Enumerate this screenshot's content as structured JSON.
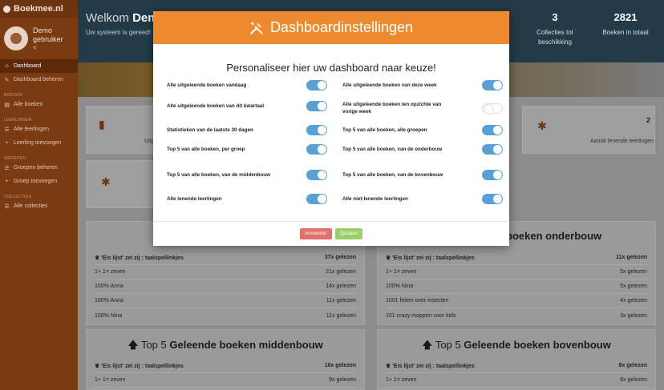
{
  "brand": {
    "name": "Boekmee.nl"
  },
  "user": {
    "name": "Demo gebruiker",
    "arrow": "<"
  },
  "sidebar": {
    "dashboard": "Dashboard",
    "dashboard_manage": "Dashboard beheren",
    "section_books": "BOEKEN",
    "all_books": "Alle boeken",
    "section_students": "LEERLINGEN",
    "all_students": "Alle leerlingen",
    "add_student": "Leerling toevoegen",
    "section_groups": "GROEPEN",
    "manage_groups": "Groepen beheren",
    "add_group": "Groep toevoegen",
    "section_collections": "COLLECTIES",
    "all_collections": "Alle collecties"
  },
  "hero": {
    "welcome_prefix": "Welkom",
    "welcome_name": "Demo",
    "sub": "Uw systeem is gereed!",
    "stat1_value": "3",
    "stat1_label": "Collecties tot beschikking",
    "stat2_value": "2821",
    "stat2_label": "Boeken in totaal"
  },
  "cards": {
    "partial_left": "Uitg",
    "lending_count": "2",
    "lending_label": "Aantal lenende leerlingen"
  },
  "panels": {
    "top_right_title": "boeken onderbouw",
    "bottom_left_title_pre": "Top 5",
    "bottom_left_title_bold": "Geleende boeken middenbouw",
    "bottom_right_title_pre": "Top 5",
    "bottom_right_title_bold": "Geleende boeken bovenbouw",
    "left_rows": [
      {
        "t": "'Eis lijst' zei zij : taalspellinkjes",
        "v": "37x gelezen"
      },
      {
        "t": "1+ 1= zeven",
        "v": "21x gelezen"
      },
      {
        "t": "100% Anna",
        "v": "14x gelezen"
      },
      {
        "t": "100% Anna",
        "v": "11x gelezen"
      },
      {
        "t": "100% Nina",
        "v": "11x gelezen"
      }
    ],
    "right_rows": [
      {
        "t": "'Eis lijst' zei zij : taalspellinkjes",
        "v": "11x gelezen"
      },
      {
        "t": "1+ 1= zeven",
        "v": "5x gelezen"
      },
      {
        "t": "100% Nina",
        "v": "5x gelezen"
      },
      {
        "t": "1001 feiten over insecten",
        "v": "4x gelezen"
      },
      {
        "t": "101 crazy moppen voor kids",
        "v": "3x gelezen"
      }
    ],
    "bl_rows": [
      {
        "t": "'Eis lijst' zei zij : taalspellinkjes",
        "v": "16x gelezen"
      },
      {
        "t": "1+ 1= zeven",
        "v": "9x gelezen"
      }
    ],
    "br_rows": [
      {
        "t": "'Eis lijst' zei zij : taalspellinkjes",
        "v": "8x gelezen"
      },
      {
        "t": "1+ 1= zeven",
        "v": "6x gelezen"
      }
    ]
  },
  "modal": {
    "title": "Dashboardinstellingen",
    "intro": "Personaliseer hier uw dashboard naar keuze!",
    "options": [
      {
        "label": "Alle uitgeleende boeken vandaag",
        "on": true
      },
      {
        "label": "Alle uitgeleende boeken van deze week",
        "on": true
      },
      {
        "label": "Alle uitgeleende boeken van dit kwartaal",
        "on": true
      },
      {
        "label": "Alle uitgeleende boeken ten opzichte van vorige week",
        "on": false
      },
      {
        "label": "Statistieken van de laatste 30 dagen",
        "on": true
      },
      {
        "label": "Top 5 van alle boeken, alle groepen",
        "on": true
      },
      {
        "label": "Top 5 van alle boeken, per groep",
        "on": true
      },
      {
        "label": "Top 5 van alle boeken, van de onderbouw",
        "on": true
      },
      {
        "label": "Top 5 van alle boeken, van de middenbouw",
        "on": true
      },
      {
        "label": "Top 5 van alle boeken, van de bovenbouw",
        "on": true
      },
      {
        "label": "Alle lenende leerlingen",
        "on": true
      },
      {
        "label": "Alle niet-lenende leerlingen",
        "on": true
      }
    ],
    "cancel_label": "Annuleren",
    "save_label": "Opslaan"
  }
}
